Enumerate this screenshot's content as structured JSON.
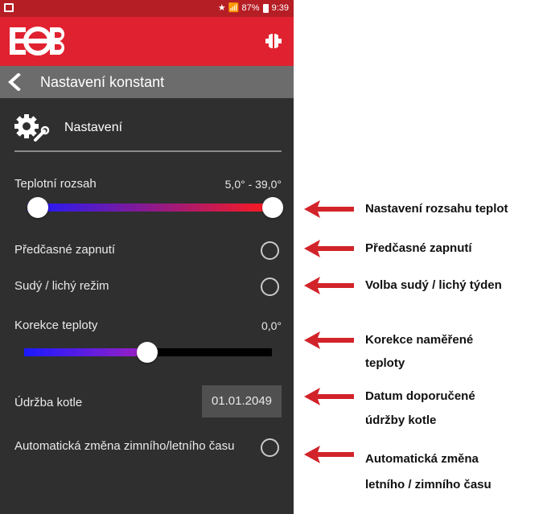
{
  "status_bar": {
    "text": "★ 📶 87%",
    "clock": "9:39"
  },
  "app_bar": {
    "logo_text": "EOB",
    "brand_color": "#e02230"
  },
  "title_bar": {
    "title": "Nastavení konstant"
  },
  "section": {
    "title": "Nastavení"
  },
  "rows": {
    "temp_range": {
      "label": "Teplotní rozsah",
      "value": "5,0° - 39,0°",
      "slider_min": 0.0,
      "slider_max": 1.0
    },
    "early_start": {
      "label": "Předčasné zapnutí",
      "checked": false
    },
    "odd_even": {
      "label": "Sudý / lichý režim",
      "checked": false
    },
    "temp_correction": {
      "label": "Korekce teploty",
      "value": "0,0°",
      "slider_position": 0.5
    },
    "boiler_maintenance": {
      "label": "Údržba kotle",
      "date": "01.01.2049"
    },
    "dst_change": {
      "label": "Automatická změna zimního/letního času",
      "checked": false
    }
  },
  "annotations": {
    "temp_range": "Nastavení rozsahu teplot",
    "early_start": "Předčasné zapnutí",
    "odd_even": "Volba sudý / lichý týden",
    "temp_correction_line1": "Korekce naměřené",
    "temp_correction_line2": "teploty",
    "maintenance_line1": "Datum doporučené",
    "maintenance_line2": "údržby kotle",
    "dst_line1": "Automatická změna",
    "dst_line2": "letního / zimního času"
  },
  "colors": {
    "annotation_arrow": "#d2232a",
    "slider_start": "#1a1aff",
    "slider_end": "#ff1a1a"
  }
}
